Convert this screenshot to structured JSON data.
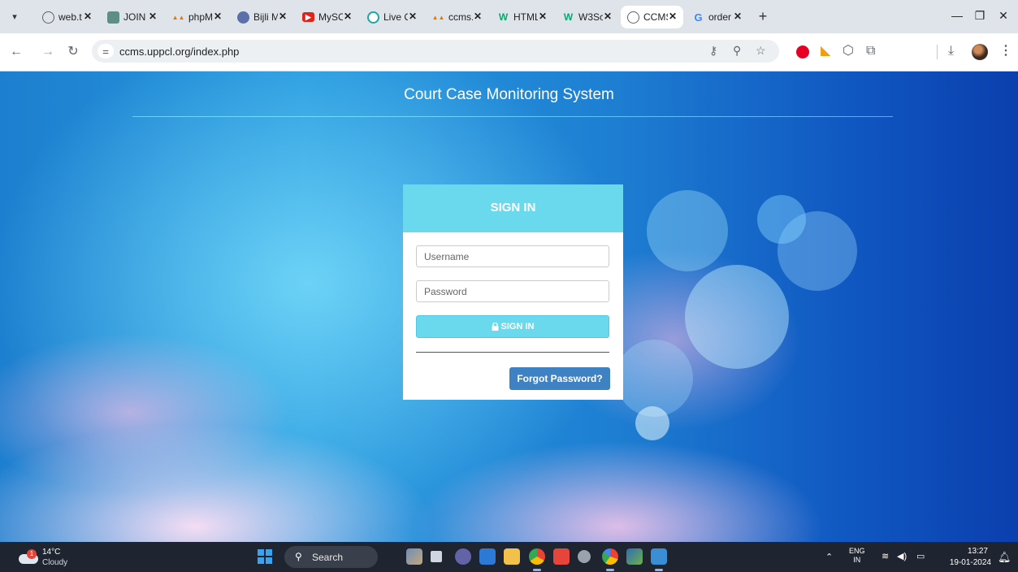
{
  "browser": {
    "tabs": [
      {
        "title": "web.t",
        "icon": "globe-icon",
        "active": false
      },
      {
        "title": "JOIN",
        "icon": "join-icon",
        "active": false
      },
      {
        "title": "phpM",
        "icon": "phpmyadmin-icon",
        "active": false
      },
      {
        "title": "Bijli M",
        "icon": "bijli-icon",
        "active": false
      },
      {
        "title": "MySC",
        "icon": "youtube-icon",
        "active": false
      },
      {
        "title": "Live C",
        "icon": "live-icon",
        "active": false
      },
      {
        "title": "ccms.",
        "icon": "phpmyadmin-icon",
        "active": false
      },
      {
        "title": "HTML",
        "icon": "w3schools-icon",
        "active": false
      },
      {
        "title": "W3Sc",
        "icon": "w3schools-icon",
        "active": false
      },
      {
        "title": "CCMS",
        "icon": "globe-icon",
        "active": true
      },
      {
        "title": "order",
        "icon": "google-icon",
        "active": false
      }
    ],
    "close_glyph": "✕",
    "new_tab_glyph": "+",
    "url": "ccms.uppcl.org/index.php"
  },
  "page": {
    "title": "Court Case Monitoring System",
    "login": {
      "heading": "SIGN IN",
      "username_placeholder": "Username",
      "password_placeholder": "Password",
      "submit_label": "SIGN IN",
      "forgot_label": "Forgot Password?"
    }
  },
  "taskbar": {
    "weather": {
      "temp": "14°C",
      "condition": "Cloudy",
      "badge": "1"
    },
    "search_label": "Search",
    "language": {
      "line1": "ENG",
      "line2": "IN"
    },
    "time": "13:27",
    "date": "19-01-2024"
  },
  "colors": {
    "accent_cyan": "#6ad9ee",
    "forgot_blue": "#3f82c4",
    "taskbar": "#1f2530"
  }
}
